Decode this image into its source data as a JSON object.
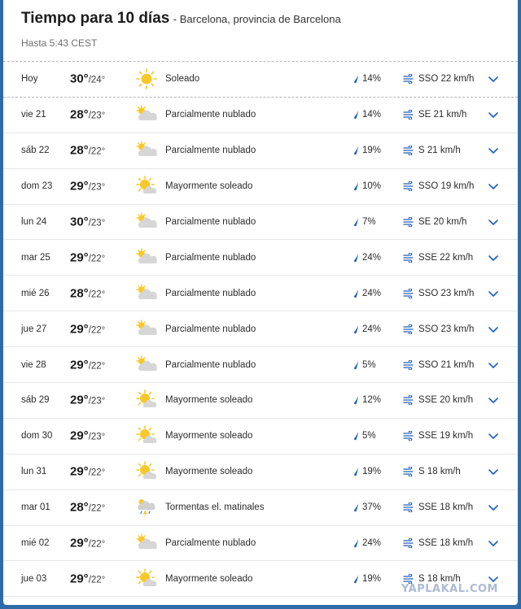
{
  "header": {
    "title": "Tiempo para 10 días",
    "location": "- Barcelona, provincia de Barcelona",
    "updated": "Hasta 5:43 CEST"
  },
  "days": [
    {
      "day": "Hoy",
      "hi": "30°",
      "lo": "/24°",
      "icon": "sun-icon",
      "condition": "Soleado",
      "precip": "14%",
      "wind": "SSO 22 km/h"
    },
    {
      "day": "vie 21",
      "hi": "28°",
      "lo": "/23°",
      "icon": "partly-cloudy-icon",
      "condition": "Parcialmente nublado",
      "precip": "14%",
      "wind": "SE 21 km/h"
    },
    {
      "day": "sáb 22",
      "hi": "28°",
      "lo": "/22°",
      "icon": "partly-cloudy-icon",
      "condition": "Parcialmente nublado",
      "precip": "19%",
      "wind": "S 21 km/h"
    },
    {
      "day": "dom 23",
      "hi": "29°",
      "lo": "/23°",
      "icon": "mostly-sunny-icon",
      "condition": "Mayormente soleado",
      "precip": "10%",
      "wind": "SSO 19 km/h"
    },
    {
      "day": "lun 24",
      "hi": "30°",
      "lo": "/23°",
      "icon": "partly-cloudy-icon",
      "condition": "Parcialmente nublado",
      "precip": "7%",
      "wind": "SE 20 km/h"
    },
    {
      "day": "mar 25",
      "hi": "29°",
      "lo": "/22°",
      "icon": "partly-cloudy-icon",
      "condition": "Parcialmente nublado",
      "precip": "24%",
      "wind": "SSE 22 km/h"
    },
    {
      "day": "mié 26",
      "hi": "28°",
      "lo": "/22°",
      "icon": "partly-cloudy-icon",
      "condition": "Parcialmente nublado",
      "precip": "24%",
      "wind": "SSO 23 km/h"
    },
    {
      "day": "jue 27",
      "hi": "29°",
      "lo": "/22°",
      "icon": "partly-cloudy-icon",
      "condition": "Parcialmente nublado",
      "precip": "24%",
      "wind": "SSO 23 km/h"
    },
    {
      "day": "vie 28",
      "hi": "29°",
      "lo": "/22°",
      "icon": "partly-cloudy-icon",
      "condition": "Parcialmente nublado",
      "precip": "5%",
      "wind": "SSO 21 km/h"
    },
    {
      "day": "sáb 29",
      "hi": "29°",
      "lo": "/23°",
      "icon": "mostly-sunny-icon",
      "condition": "Mayormente soleado",
      "precip": "12%",
      "wind": "SSE 20 km/h"
    },
    {
      "day": "dom 30",
      "hi": "29°",
      "lo": "/23°",
      "icon": "mostly-sunny-icon",
      "condition": "Mayormente soleado",
      "precip": "5%",
      "wind": "SSE 19 km/h"
    },
    {
      "day": "lun 31",
      "hi": "29°",
      "lo": "/22°",
      "icon": "mostly-sunny-icon",
      "condition": "Mayormente soleado",
      "precip": "19%",
      "wind": "S 18 km/h"
    },
    {
      "day": "mar 01",
      "hi": "28°",
      "lo": "/22°",
      "icon": "thunderstorm-icon",
      "condition": "Tormentas el. matinales",
      "precip": "37%",
      "wind": "SSE 18 km/h"
    },
    {
      "day": "mié 02",
      "hi": "29°",
      "lo": "/22°",
      "icon": "partly-cloudy-icon",
      "condition": "Parcialmente nublado",
      "precip": "24%",
      "wind": "SSE 18 km/h"
    },
    {
      "day": "jue 03",
      "hi": "29°",
      "lo": "/22°",
      "icon": "mostly-sunny-icon",
      "condition": "Mayormente soleado",
      "precip": "19%",
      "wind": "S 18 km/h"
    }
  ],
  "watermark": "YAPLAKAL.COM",
  "colors": {
    "background": "#2f6aa8",
    "accent": "#1f5fbf",
    "sun": "#f5c518",
    "cloud": "#d6d6d6"
  }
}
